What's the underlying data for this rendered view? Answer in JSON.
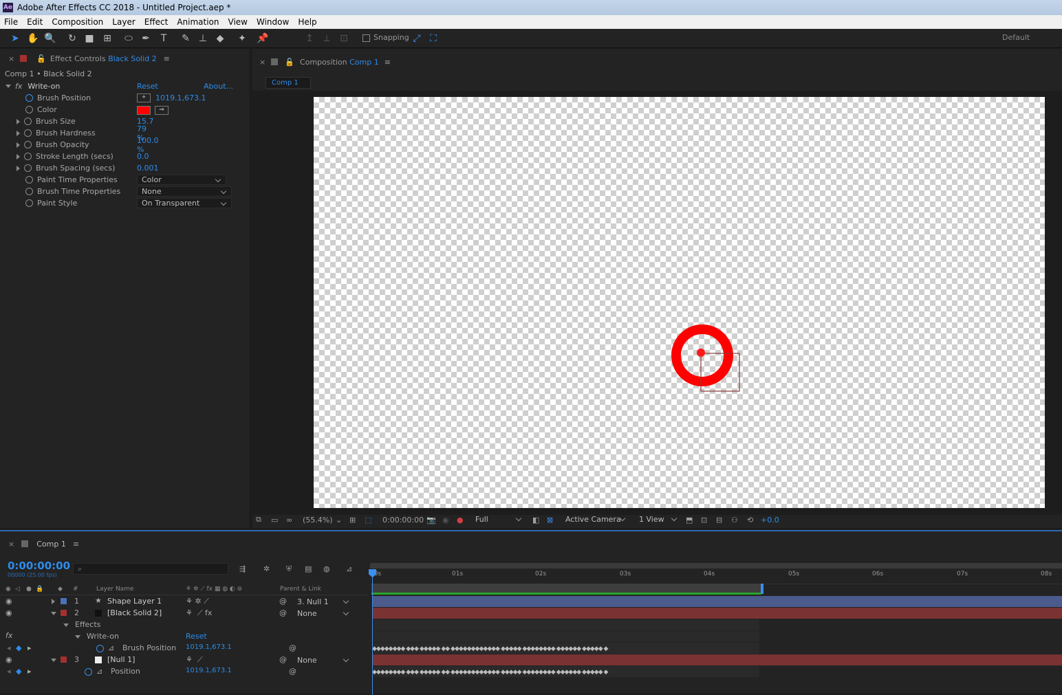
{
  "window": {
    "title": "Adobe After Effects CC 2018 - Untitled Project.aep *",
    "app_badge": "Ae"
  },
  "menu": [
    "File",
    "Edit",
    "Composition",
    "Layer",
    "Effect",
    "Animation",
    "View",
    "Window",
    "Help"
  ],
  "toolbar": {
    "snapping": "Snapping",
    "workspace": "Default"
  },
  "effect_controls": {
    "tab_label": "Effect Controls",
    "tab_layer": "Black Solid 2",
    "breadcrumb": "Comp 1 • Black Solid 2",
    "effect_name": "Write-on",
    "reset": "Reset",
    "about": "About...",
    "props": [
      {
        "name": "Brush Position",
        "value": "1019.1,673.1",
        "type": "point"
      },
      {
        "name": "Color",
        "value": "",
        "type": "color"
      },
      {
        "name": "Brush Size",
        "value": "15.7",
        "type": "num"
      },
      {
        "name": "Brush Hardness",
        "value": "79 %",
        "type": "num"
      },
      {
        "name": "Brush Opacity",
        "value": "100.0 %",
        "type": "num"
      },
      {
        "name": "Stroke Length (secs)",
        "value": "0.0",
        "type": "num"
      },
      {
        "name": "Brush Spacing (secs)",
        "value": "0.001",
        "type": "num"
      },
      {
        "name": "Paint Time Properties",
        "value": "Color",
        "type": "select"
      },
      {
        "name": "Brush Time Properties",
        "value": "None",
        "type": "select"
      },
      {
        "name": "Paint Style",
        "value": "On Transparent",
        "type": "select"
      }
    ]
  },
  "composition": {
    "tab_label": "Composition",
    "tab_comp": "Comp 1",
    "subtab": "Comp 1",
    "zoom": "(55.4%)",
    "time": "0:00:00:00",
    "resolution": "Full",
    "camera": "Active Camera",
    "views": "1 View",
    "exposure": "+0.0"
  },
  "timeline": {
    "tab": "Comp 1",
    "timecode": "0:00:00:00",
    "frames": "00000 (25.00 fps)",
    "search_placeholder": "",
    "col_layer": "Layer Name",
    "col_parent": "Parent & Link",
    "ticks": [
      "00s",
      "01s",
      "02s",
      "03s",
      "04s",
      "05s",
      "06s",
      "07s",
      "08s"
    ],
    "layers": [
      {
        "num": "1",
        "name": "Shape Layer 1",
        "parent": "3. Null 1",
        "color": "#4b71b8"
      },
      {
        "num": "2",
        "name": "[Black Solid 2]",
        "parent": "None",
        "color": "#a33030"
      },
      {
        "num": "3",
        "name": "[Null 1]",
        "parent": "None",
        "color": "#a33030"
      }
    ],
    "effects_label": "Effects",
    "writeon_label": "Write-on",
    "reset": "Reset",
    "brush_position_label": "Brush Position",
    "brush_position_value": "1019.1,673.1",
    "position_label": "Position",
    "position_value": "1019.1,673.1",
    "keyframes": "◆◆◆◆◆◆◆◆ ◆◆◆ ◆◆◆◆◆ ◆◆ ◆◆◆◆◆◆◆◆◆◆◆◆ ◆◆◆◆◆ ◆◆◆◆◆◆◆◆ ◆◆◆◆◆◆ ◆◆◆◆◆ ◆"
  },
  "colors": {
    "accent": "#2d8ceb",
    "brush": "#ff0000"
  }
}
